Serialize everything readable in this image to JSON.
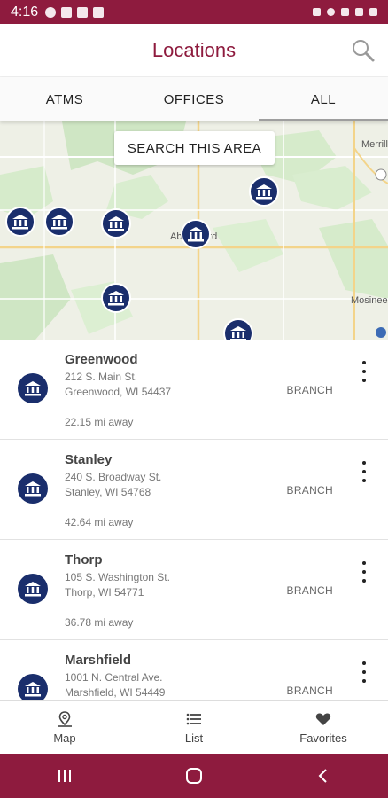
{
  "status_bar": {
    "time": "4:16"
  },
  "header": {
    "title": "Locations"
  },
  "tabs": [
    {
      "label": "ATMS",
      "active": false
    },
    {
      "label": "OFFICES",
      "active": false
    },
    {
      "label": "ALL",
      "active": true
    }
  ],
  "map": {
    "search_area_label": "SEARCH THIS AREA",
    "labels": [
      "Abbotsford",
      "Merrill",
      "Mosinee"
    ]
  },
  "locations": [
    {
      "name": "Greenwood",
      "address_line1": "212 S. Main St.",
      "address_line2": "Greenwood, WI 54437",
      "distance": "22.15 mi away",
      "type": "BRANCH"
    },
    {
      "name": "Stanley",
      "address_line1": "240 S. Broadway St.",
      "address_line2": "Stanley, WI 54768",
      "distance": "42.64 mi away",
      "type": "BRANCH"
    },
    {
      "name": "Thorp",
      "address_line1": "105 S. Washington St.",
      "address_line2": "Thorp, WI 54771",
      "distance": "36.78 mi away",
      "type": "BRANCH"
    },
    {
      "name": "Marshfield",
      "address_line1": "1001 N. Central Ave.",
      "address_line2": "Marshfield, WI 54449",
      "distance": "",
      "type": "BRANCH"
    }
  ],
  "bottom_nav": [
    {
      "label": "Map",
      "icon": "map-pin-icon"
    },
    {
      "label": "List",
      "icon": "list-icon"
    },
    {
      "label": "Favorites",
      "icon": "heart-icon"
    }
  ],
  "colors": {
    "brand": "#8e1b3e",
    "pin": "#1a2e6c"
  }
}
